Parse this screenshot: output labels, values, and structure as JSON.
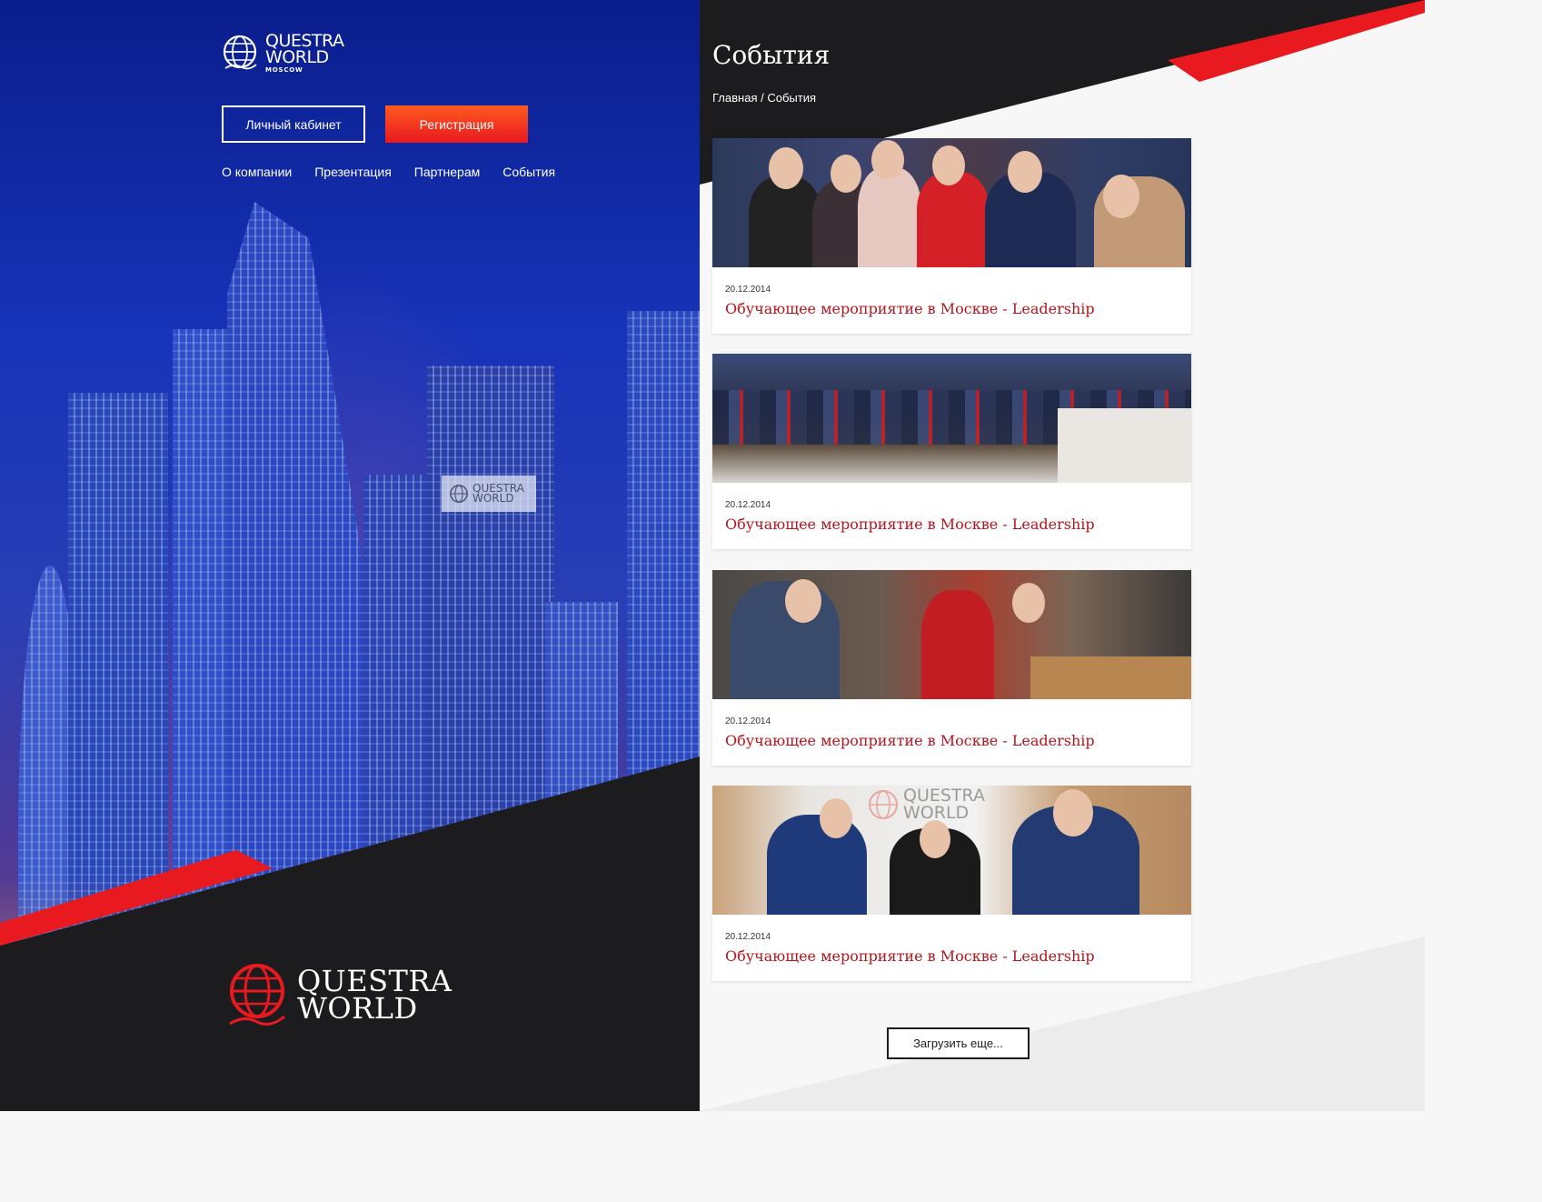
{
  "brand": {
    "line1": "QUESTRA",
    "line2": "WORLD",
    "city": "MOSCOW"
  },
  "header": {
    "account_button": "Личный кабинет",
    "register_button": "Регистрация",
    "nav": [
      "О компании",
      "Презентация",
      "Партнерам",
      "События"
    ]
  },
  "building_sign": {
    "line1": "QUESTRA",
    "line2": "WORLD"
  },
  "footer_brand": {
    "line1": "QUESTRA",
    "line2": "WORLD"
  },
  "page": {
    "title": "События",
    "breadcrumb": {
      "home": "Главная",
      "separator": " / ",
      "current": "События"
    }
  },
  "events": [
    {
      "date": "20.12.2014",
      "title": "Обучающее мероприятие в Москве - Leadership"
    },
    {
      "date": "20.12.2014",
      "title": "Обучающее мероприятие в Москве - Leadership"
    },
    {
      "date": "20.12.2014",
      "title": "Обучающее мероприятие в Москве - Leadership"
    },
    {
      "date": "20.12.2014",
      "title": "Обучающее мероприятие в Москве - Leadership"
    }
  ],
  "photo_watermark": {
    "line1": "QUESTRA",
    "line2": "WORLD"
  },
  "load_more": "Загрузить еще...",
  "colors": {
    "accent": "#e8191f",
    "dark": "#1c1c1e",
    "title_red": "#b5151c"
  }
}
